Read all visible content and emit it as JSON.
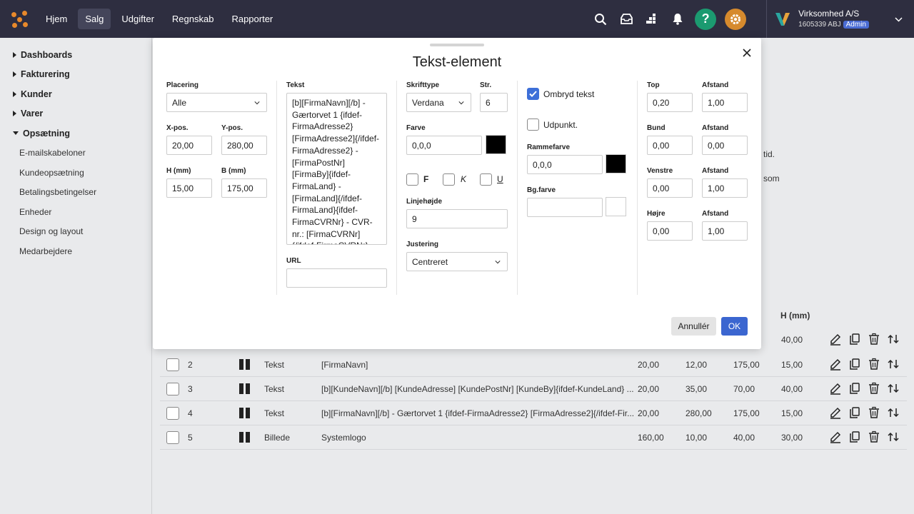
{
  "nav": {
    "items": [
      "Hjem",
      "Salg",
      "Udgifter",
      "Regnskab",
      "Rapporter"
    ],
    "active": "Salg"
  },
  "topbar": {
    "help_label": "?",
    "company_name": "Virksomhed A/S",
    "company_sub": "1605339 ABJ",
    "admin_badge": "Admin",
    "help_color": "#1b9a70",
    "settings_color": "#d68a2d"
  },
  "sidebar": {
    "groups": [
      {
        "label": "Dashboards",
        "expanded": false
      },
      {
        "label": "Fakturering",
        "expanded": false
      },
      {
        "label": "Kunder",
        "expanded": false
      },
      {
        "label": "Varer",
        "expanded": false
      },
      {
        "label": "Opsætning",
        "expanded": true
      }
    ],
    "sub_items": [
      "E-mailskabeloner",
      "Kundeopsætning",
      "Betalingsbetingelser",
      "Enheder",
      "Design og layout",
      "Medarbejdere"
    ]
  },
  "background": {
    "text_fragment_1": "tid.",
    "text_fragment_2": "som",
    "table_header_h": "H (mm)",
    "first_row_h": "40,00",
    "rows": [
      {
        "num": "2",
        "type": "Tekst",
        "content": "[FirmaNavn]",
        "x": "20,00",
        "y": "12,00",
        "b": "175,00",
        "h": "15,00"
      },
      {
        "num": "3",
        "type": "Tekst",
        "content": "[b][KundeNavn][/b] [KundeAdresse] [KundePostNr] [KundeBy]{ifdef-KundeLand} ...",
        "x": "20,00",
        "y": "35,00",
        "b": "70,00",
        "h": "40,00"
      },
      {
        "num": "4",
        "type": "Tekst",
        "content": "[b][FirmaNavn][/b] - Gærtorvet 1 {ifdef-FirmaAdresse2} [FirmaAdresse2]{/ifdef-Fir...",
        "x": "20,00",
        "y": "280,00",
        "b": "175,00",
        "h": "15,00"
      },
      {
        "num": "5",
        "type": "Billede",
        "content": "Systemlogo",
        "x": "160,00",
        "y": "10,00",
        "b": "40,00",
        "h": "30,00"
      }
    ]
  },
  "modal": {
    "title": "Tekst-element",
    "placering": {
      "label": "Placering",
      "value": "Alle"
    },
    "xpos": {
      "label": "X-pos.",
      "value": "20,00"
    },
    "ypos": {
      "label": "Y-pos.",
      "value": "280,00"
    },
    "h_mm": {
      "label": "H (mm)",
      "value": "15,00"
    },
    "b_mm": {
      "label": "B (mm)",
      "value": "175,00"
    },
    "tekst": {
      "label": "Tekst",
      "value": "[b][FirmaNavn][/b] - Gærtorvet 1 {ifdef-FirmaAdresse2} [FirmaAdresse2]{/ifdef-FirmaAdresse2} - [FirmaPostNr] [FirmaBy]{ifdef-FirmaLand} - [FirmaLand]{/ifdef-FirmaLand}{ifdef-FirmaCVRNr} - CVR-nr.: [FirmaCVRNr]{/ifdef-FirmaCVRNr}{ifdef-FirmaTelefon}Tlf.:"
    },
    "url": {
      "label": "URL",
      "value": ""
    },
    "skrifttype": {
      "label": "Skrifttype",
      "value": "Verdana"
    },
    "str": {
      "label": "Str.",
      "value": "6"
    },
    "farve": {
      "label": "Farve",
      "value": "0,0,0",
      "swatch": "#000000"
    },
    "bold_label": "F",
    "italic_label": "K",
    "underline_label": "U",
    "linjehojde": {
      "label": "Linjehøjde",
      "value": "9"
    },
    "justering": {
      "label": "Justering",
      "value": "Centreret"
    },
    "ombryd": {
      "label": "Ombryd tekst",
      "checked": true
    },
    "udpunkt": {
      "label": "Udpunkt.",
      "checked": false
    },
    "rammefarve": {
      "label": "Rammefarve",
      "value": "0,0,0",
      "swatch": "#000000"
    },
    "bgfarve": {
      "label": "Bg.farve",
      "value": "",
      "swatch": "#ffffff"
    },
    "top": {
      "label": "Top",
      "value": "0,20"
    },
    "top_afstand": {
      "label": "Afstand",
      "value": "1,00"
    },
    "bund": {
      "label": "Bund",
      "value": "0,00"
    },
    "bund_afstand": {
      "label": "Afstand",
      "value": "0,00"
    },
    "venstre": {
      "label": "Venstre",
      "value": "0,00"
    },
    "venstre_afstand": {
      "label": "Afstand",
      "value": "1,00"
    },
    "hojre": {
      "label": "Højre",
      "value": "0,00"
    },
    "hojre_afstand": {
      "label": "Afstand",
      "value": "1,00"
    },
    "cancel_label": "Annullér",
    "ok_label": "OK",
    "ok_color": "#3b66d0"
  }
}
